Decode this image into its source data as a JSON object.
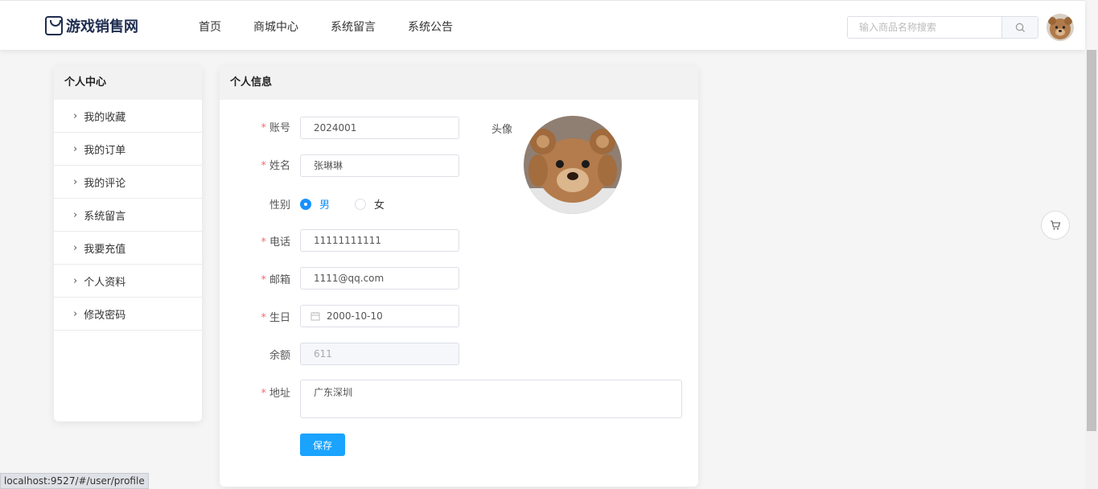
{
  "header": {
    "logo_text": "游戏销售网",
    "nav": [
      "首页",
      "商城中心",
      "系统留言",
      "系统公告"
    ],
    "search_placeholder": "输入商品名称搜索"
  },
  "sidebar": {
    "title": "个人中心",
    "items": [
      "我的收藏",
      "我的订单",
      "我的评论",
      "系统留言",
      "我要充值",
      "个人资料",
      "修改密码"
    ]
  },
  "profile": {
    "title": "个人信息",
    "account_label": "账号",
    "account": "2024001",
    "name_label": "姓名",
    "name": "张琳琳",
    "gender_label": "性别",
    "gender_male": "男",
    "gender_female": "女",
    "phone_label": "电话",
    "phone": "11111111111",
    "email_label": "邮箱",
    "email": "1111@qq.com",
    "birthday_label": "生日",
    "birthday": "2000-10-10",
    "balance_label": "余额",
    "balance": "611",
    "address_label": "地址",
    "address": "广东深圳",
    "avatar_label": "头像",
    "save_label": "保存"
  },
  "status_url": "localhost:9527/#/user/profile",
  "colors": {
    "accent": "#1aa3ff",
    "required": "#f56c6c"
  }
}
